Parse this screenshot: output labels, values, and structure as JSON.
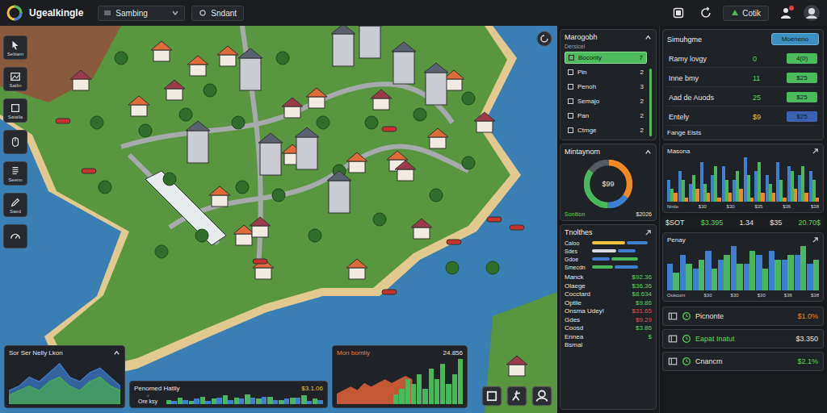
{
  "app": {
    "title": "Ugealkingle"
  },
  "topbar": {
    "dropdown": {
      "value": "Sambing"
    },
    "field": {
      "value": "Sndant"
    },
    "action_button": "Cotik",
    "notification": true
  },
  "toolbar": [
    {
      "label": "Selttam"
    },
    {
      "label": "Satlin"
    },
    {
      "label": "Satalla"
    },
    {},
    {
      "label": "Seenn"
    },
    {
      "label": "Saed"
    },
    {}
  ],
  "map": {
    "cards": [
      {
        "kind": "area",
        "title": "Sor Ser Nelly Lkon",
        "series": [
          {
            "color": "#3f7fd0",
            "values": [
              3,
              4,
              6,
              5,
              7,
              9,
              6,
              5,
              7,
              8,
              6,
              4
            ]
          },
          {
            "color": "#4caf50",
            "values": [
              2,
              3,
              4,
              3,
              5,
              6,
              4,
              3,
              5,
              6,
              4,
              3
            ]
          }
        ]
      },
      {
        "kind": "gauge",
        "title": "Penomed Hatily",
        "value": "$3.1.06",
        "gauge": {
          "level": 0.62,
          "label": "Ore ksy"
        },
        "series": [
          {
            "color": "#49b85a",
            "values": [
              4,
              6,
              3,
              7,
              5,
              8,
              6,
              9,
              5,
              7,
              4,
              6,
              8,
              5
            ]
          },
          {
            "color": "#3f7fd0",
            "values": [
              3,
              4,
              5,
              3,
              6,
              4,
              5,
              6,
              7,
              4,
              5,
              6,
              3,
              4
            ]
          }
        ]
      },
      {
        "kind": "combo",
        "title": "Mon bomliy",
        "value": "24.856",
        "area": {
          "color": "#e0603a",
          "values": [
            3,
            4,
            5,
            4,
            6,
            5,
            6,
            7,
            6,
            7,
            8,
            7
          ]
        },
        "series": [
          {
            "color": "#49b85a",
            "values": [
              2,
              3,
              5,
              4,
              6,
              3,
              7,
              5,
              8,
              4,
              6,
              9
            ]
          }
        ]
      }
    ]
  },
  "filters": {
    "title": "Marogobh",
    "subtitle": "Dersicel",
    "items": [
      {
        "label": "Boconty",
        "count": "7",
        "selected": true
      },
      {
        "label": "Pin",
        "count": "2",
        "selected": false
      },
      {
        "label": "Penoh",
        "count": "3",
        "selected": false
      },
      {
        "label": "Semajo",
        "count": "2",
        "selected": false
      },
      {
        "label": "Pan",
        "count": "2",
        "selected": false
      },
      {
        "label": "Ctmge",
        "count": "2",
        "selected": false
      }
    ]
  },
  "budget": {
    "title": "Mintaynom",
    "center": "$99",
    "segments": [
      {
        "value": 35,
        "color": "#f08a24"
      },
      {
        "value": 15,
        "color": "#3f7fd0"
      },
      {
        "value": 35,
        "color": "#49b85a"
      },
      {
        "value": 15,
        "color": "#555b63"
      }
    ],
    "footer_label": "Sonition",
    "footer_value": "$2026"
  },
  "trends": {
    "title": "Tnolthes",
    "bars": [
      {
        "label": "Caloo",
        "segments": [
          {
            "level": 0.55,
            "color": "#f0c040"
          },
          {
            "level": 0.35,
            "color": "#3f7fd0"
          }
        ]
      },
      {
        "label": "Sdes",
        "segments": [
          {
            "level": 0.4,
            "color": "#d9dde2"
          },
          {
            "level": 0.3,
            "color": "#3f7fd0"
          }
        ]
      },
      {
        "label": "Gdoe",
        "segments": [
          {
            "level": 0.3,
            "color": "#3f7fd0"
          },
          {
            "level": 0.45,
            "color": "#49b85a"
          }
        ]
      },
      {
        "label": "Smecdn",
        "segments": [
          {
            "level": 0.35,
            "color": "#49b85a"
          },
          {
            "level": 0.4,
            "color": "#3f7fd0"
          }
        ]
      }
    ],
    "rows": [
      {
        "label": "Manck",
        "value": "$92.36",
        "color": "#5fd35f"
      },
      {
        "label": "Olaege",
        "value": "$36.36",
        "color": "#5fd35f"
      },
      {
        "label": "Cocctard",
        "value": "$8.634",
        "color": "#5fd35f"
      },
      {
        "label": "Optile",
        "value": "$9.86",
        "color": "#5fd35f"
      },
      {
        "label": "Onsma Udey!",
        "value": "$31.65",
        "color": "#e05050"
      },
      {
        "label": "Gdes",
        "value": "$9.29",
        "color": "#e05050"
      },
      {
        "label": "Coosd",
        "value": "$3.86",
        "color": "#5fd35f"
      },
      {
        "label": "Ennea",
        "value": "$",
        "color": "#5fd35f"
      },
      {
        "label": "Bsmal"
      }
    ]
  },
  "simulation": {
    "title": "Simuhgme",
    "button": "Moeneno",
    "rows": [
      {
        "label": "Ramy lovgy",
        "value": "0",
        "value_color": "#5fd35f",
        "badge": "4(0)",
        "color": "#4cbb5c"
      },
      {
        "label": "Inne bmy",
        "value": "11",
        "value_color": "#5fd35f",
        "badge": "$25",
        "color": "#4cbb5c"
      },
      {
        "label": "Aad de Auods",
        "value": "25",
        "value_color": "#5fd35f",
        "badge": "$25",
        "color": "#4cbb5c"
      },
      {
        "label": "Entely",
        "value": "$9",
        "value_color": "#f0c040",
        "badge": "$25",
        "color": "#3a62b0"
      }
    ],
    "footer": "Fange Eists"
  },
  "chart1": {
    "title": "Masona",
    "labels": [
      "Nmlo",
      "$30",
      "$30",
      "$35",
      "$36",
      "$38"
    ],
    "series": [
      {
        "color": "#3f7fd0",
        "values": [
          5,
          7,
          4,
          9,
          6,
          8,
          5,
          10,
          7,
          6,
          9,
          8,
          6,
          7
        ]
      },
      {
        "color": "#49b85a",
        "values": [
          3,
          5,
          6,
          4,
          8,
          5,
          7,
          6,
          9,
          4,
          5,
          7,
          8,
          5
        ]
      },
      {
        "color": "#f08a24",
        "values": [
          2,
          1,
          3,
          2,
          1,
          2,
          3,
          1,
          2,
          2,
          1,
          3,
          2,
          1
        ]
      }
    ]
  },
  "stats": [
    {
      "text": "$SOT",
      "color": "#e6e6e6"
    },
    {
      "text": "$3.395",
      "color": "#5fd35f"
    },
    {
      "text": "1.34",
      "color": "#e6e6e6"
    },
    {
      "text": "$35",
      "color": "#e6e6e6"
    },
    {
      "text": "20.70$",
      "color": "#5fd35f"
    }
  ],
  "chart2": {
    "title": "Penay",
    "labels": [
      "Ouscom",
      "$30",
      "$30",
      "$30",
      "$36",
      "$38"
    ],
    "series": [
      {
        "color": "#3f7fd0",
        "values": [
          6,
          8,
          5,
          9,
          7,
          10,
          6,
          8,
          9,
          7,
          8,
          6
        ]
      },
      {
        "color": "#49b85a",
        "values": [
          4,
          6,
          7,
          5,
          8,
          6,
          9,
          5,
          7,
          8,
          10,
          7
        ]
      }
    ]
  },
  "list": [
    {
      "label": "Picnonte",
      "value": "$1.0%",
      "color": "#e08a2a",
      "selected": false
    },
    {
      "label": "Eapat Inatut",
      "value": "$3.350",
      "color": "#e6e6e6",
      "selected": true
    },
    {
      "label": "Cnancm",
      "value": "$2.1%",
      "color": "#5fd35f",
      "selected": false
    }
  ]
}
